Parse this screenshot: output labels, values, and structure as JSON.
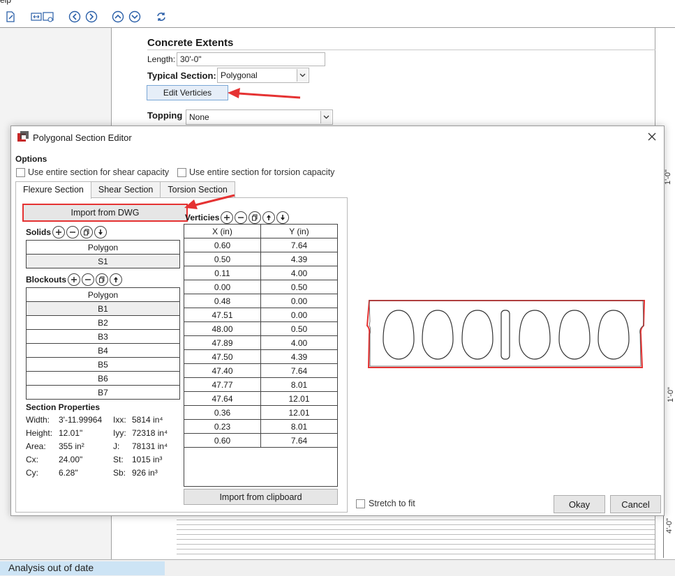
{
  "app": {
    "menu_fragment": "elp",
    "toolbar_icons": [
      "new-file-icon",
      "stretch-view-icon",
      "back-icon",
      "forward-icon",
      "up-icon",
      "down-icon",
      "refresh-icon"
    ],
    "concrete_extents": {
      "title": "Concrete Extents",
      "length_label": "Length:",
      "length_value": "30'-0\"",
      "typical_section_label": "Typical Section:",
      "typical_section_value": "Polygonal",
      "edit_verticies_label": "Edit Verticies",
      "topping_label": "Topping",
      "topping_value": "None"
    },
    "dimension_labels": [
      "1'-0\"",
      "1'-0\"",
      "4'-0\""
    ],
    "status_text": "Analysis out of date"
  },
  "dialog": {
    "title": "Polygonal Section Editor",
    "options_title": "Options",
    "chk_shear": "Use entire section for shear capacity",
    "chk_torsion": "Use entire section for torsion capacity",
    "tabs": [
      "Flexure Section",
      "Shear Section",
      "Torsion Section"
    ],
    "active_tab": "Flexure Section",
    "import_dwg_label": "Import from DWG",
    "solids_label": "Solids",
    "solids_header": "Polygon",
    "solids_rows": [
      "S1"
    ],
    "blockouts_label": "Blockouts",
    "blockouts_header": "Polygon",
    "blockouts_rows": [
      "B1",
      "B2",
      "B3",
      "B4",
      "B5",
      "B6",
      "B7"
    ],
    "section_properties": {
      "title": "Section Properties",
      "width_label": "Width:",
      "width_value": "3'-11.99964",
      "height_label": "Height:",
      "height_value": "12.01\"",
      "area_label": "Area:",
      "area_value": "355 in²",
      "cx_label": "Cx:",
      "cx_value": "24.00\"",
      "cy_label": "Cy:",
      "cy_value": "6.28\"",
      "ixx_label": "Ixx:",
      "ixx_value": "5814 in⁴",
      "iyy_label": "Iyy:",
      "iyy_value": "72318 in⁴",
      "j_label": "J:",
      "j_value": "78131 in⁴",
      "st_label": "St:",
      "st_value": "1015 in³",
      "sb_label": "Sb:",
      "sb_value": "926 in³"
    },
    "verticies_label": "Verticies",
    "vert_headers": [
      "X (in)",
      "Y (in)"
    ],
    "verticies": [
      [
        "0.60",
        "7.64"
      ],
      [
        "0.50",
        "4.39"
      ],
      [
        "0.11",
        "4.00"
      ],
      [
        "0.00",
        "0.50"
      ],
      [
        "0.48",
        "0.00"
      ],
      [
        "47.51",
        "0.00"
      ],
      [
        "48.00",
        "0.50"
      ],
      [
        "47.89",
        "4.00"
      ],
      [
        "47.50",
        "4.39"
      ],
      [
        "47.40",
        "7.64"
      ],
      [
        "47.77",
        "8.01"
      ],
      [
        "47.64",
        "12.01"
      ],
      [
        "0.36",
        "12.01"
      ],
      [
        "0.23",
        "8.01"
      ],
      [
        "0.60",
        "7.64"
      ]
    ],
    "import_clipboard_label": "Import from clipboard",
    "stretch_label": "Stretch to fit",
    "okay_label": "Okay",
    "cancel_label": "Cancel",
    "accent_color": "#e53232"
  }
}
